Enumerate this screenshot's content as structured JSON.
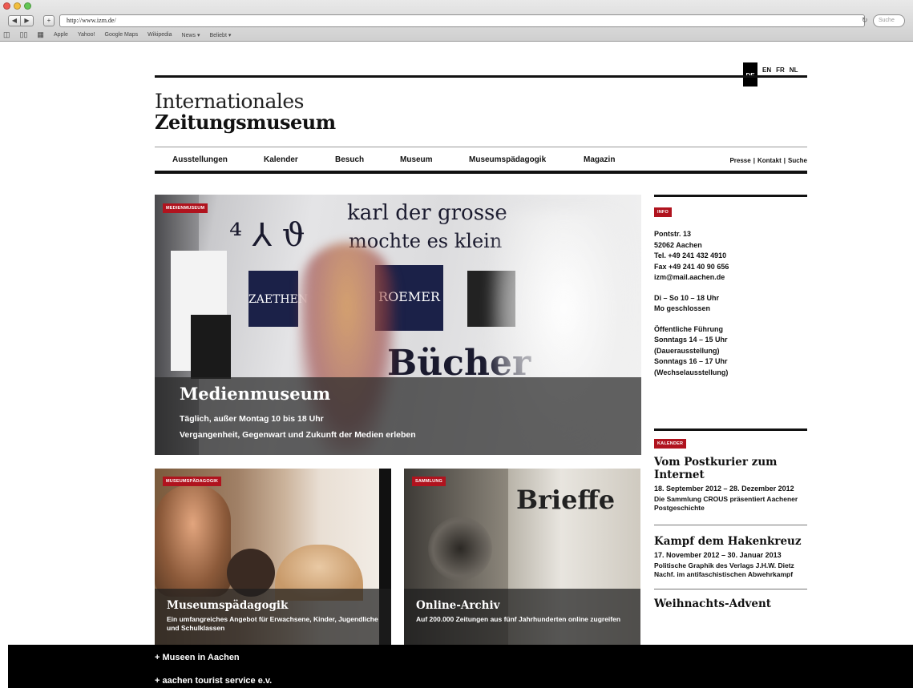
{
  "browser": {
    "url": "http://www.izm.de/",
    "search_placeholder": "Suche",
    "bookmarks": [
      "Apple",
      "Yahoo!",
      "Google Maps",
      "Wikipedia",
      "News ▾",
      "Beliebt ▾"
    ]
  },
  "header": {
    "languages": {
      "active": "DE",
      "others": [
        "EN",
        "FR",
        "NL"
      ]
    },
    "logo_line1": "Internationales",
    "logo_line2": "Zeitungsmuseum"
  },
  "nav": {
    "items": [
      "Ausstellungen",
      "Kalender",
      "Besuch",
      "Museum",
      "Museumspädagogik",
      "Magazin"
    ],
    "util": [
      "Presse",
      "Kontakt",
      "Suche"
    ],
    "separator": "|"
  },
  "hero": {
    "tag": "MEDIENMUSEUM",
    "title": "Medienmuseum",
    "line1": "Täglich, außer Montag 10 bis 18 Uhr",
    "line2": "Vergangenheit, Gegenwart und Zukunft der Medien erleben",
    "wall_text1": "karl der grosse",
    "wall_text2": "mochte es klein",
    "wall_text3": "Bücher",
    "poster1": "ZAETHEN",
    "poster2": "ROEMER"
  },
  "tiles": [
    {
      "tag": "MUSEUMSPÄDAGOGIK",
      "title": "Museumspädagogik",
      "sub": "Ein umfangreiches Angebot für Erwachsene, Kinder, Jugendliche und Schulklassen"
    },
    {
      "tag": "SAMMLUNG",
      "title": "Online-Archiv",
      "sub": "Auf 200.000 Zeitungen aus fünf Jahrhunderten online zugreifen",
      "book_text": "Brieffe"
    }
  ],
  "info": {
    "tag": "INFO",
    "address": [
      "Pontstr. 13",
      "52062 Aachen",
      "Tel. +49 241 432 4910",
      "Fax +49 241 40 90 656",
      "izm@mail.aachen.de"
    ],
    "hours": [
      "Di – So 10 – 18 Uhr",
      "Mo geschlossen"
    ],
    "tours": [
      "Öffentliche Führung",
      "Sonntags 14 – 15 Uhr",
      "(Dauerausstellung)",
      "Sonntags 16 – 17 Uhr",
      "(Wechselausstellung)"
    ]
  },
  "kalender": {
    "tag": "KALENDER",
    "events": [
      {
        "title": "Vom Postkurier zum Internet",
        "date": "18. September 2012 – 28. Dezember 2012",
        "desc": "Die Sammlung CROUS präsentiert Aachener Postgeschichte"
      },
      {
        "title": "Kampf dem Hakenkreuz",
        "date": "17. November 2012 – 30. Januar 2013",
        "desc": "Politische Graphik des Verlags J.H.W. Dietz Nachf. im antifaschistischen Abwehrkampf"
      }
    ],
    "partial_title": "Weihnachts-Advent"
  },
  "footer": {
    "link1": "+ Museen in Aachen",
    "link2": "+ aachen tourist service e.v."
  },
  "colors": {
    "accent_red": "#b0131e",
    "black": "#111111",
    "footer_bg": "#000000"
  }
}
